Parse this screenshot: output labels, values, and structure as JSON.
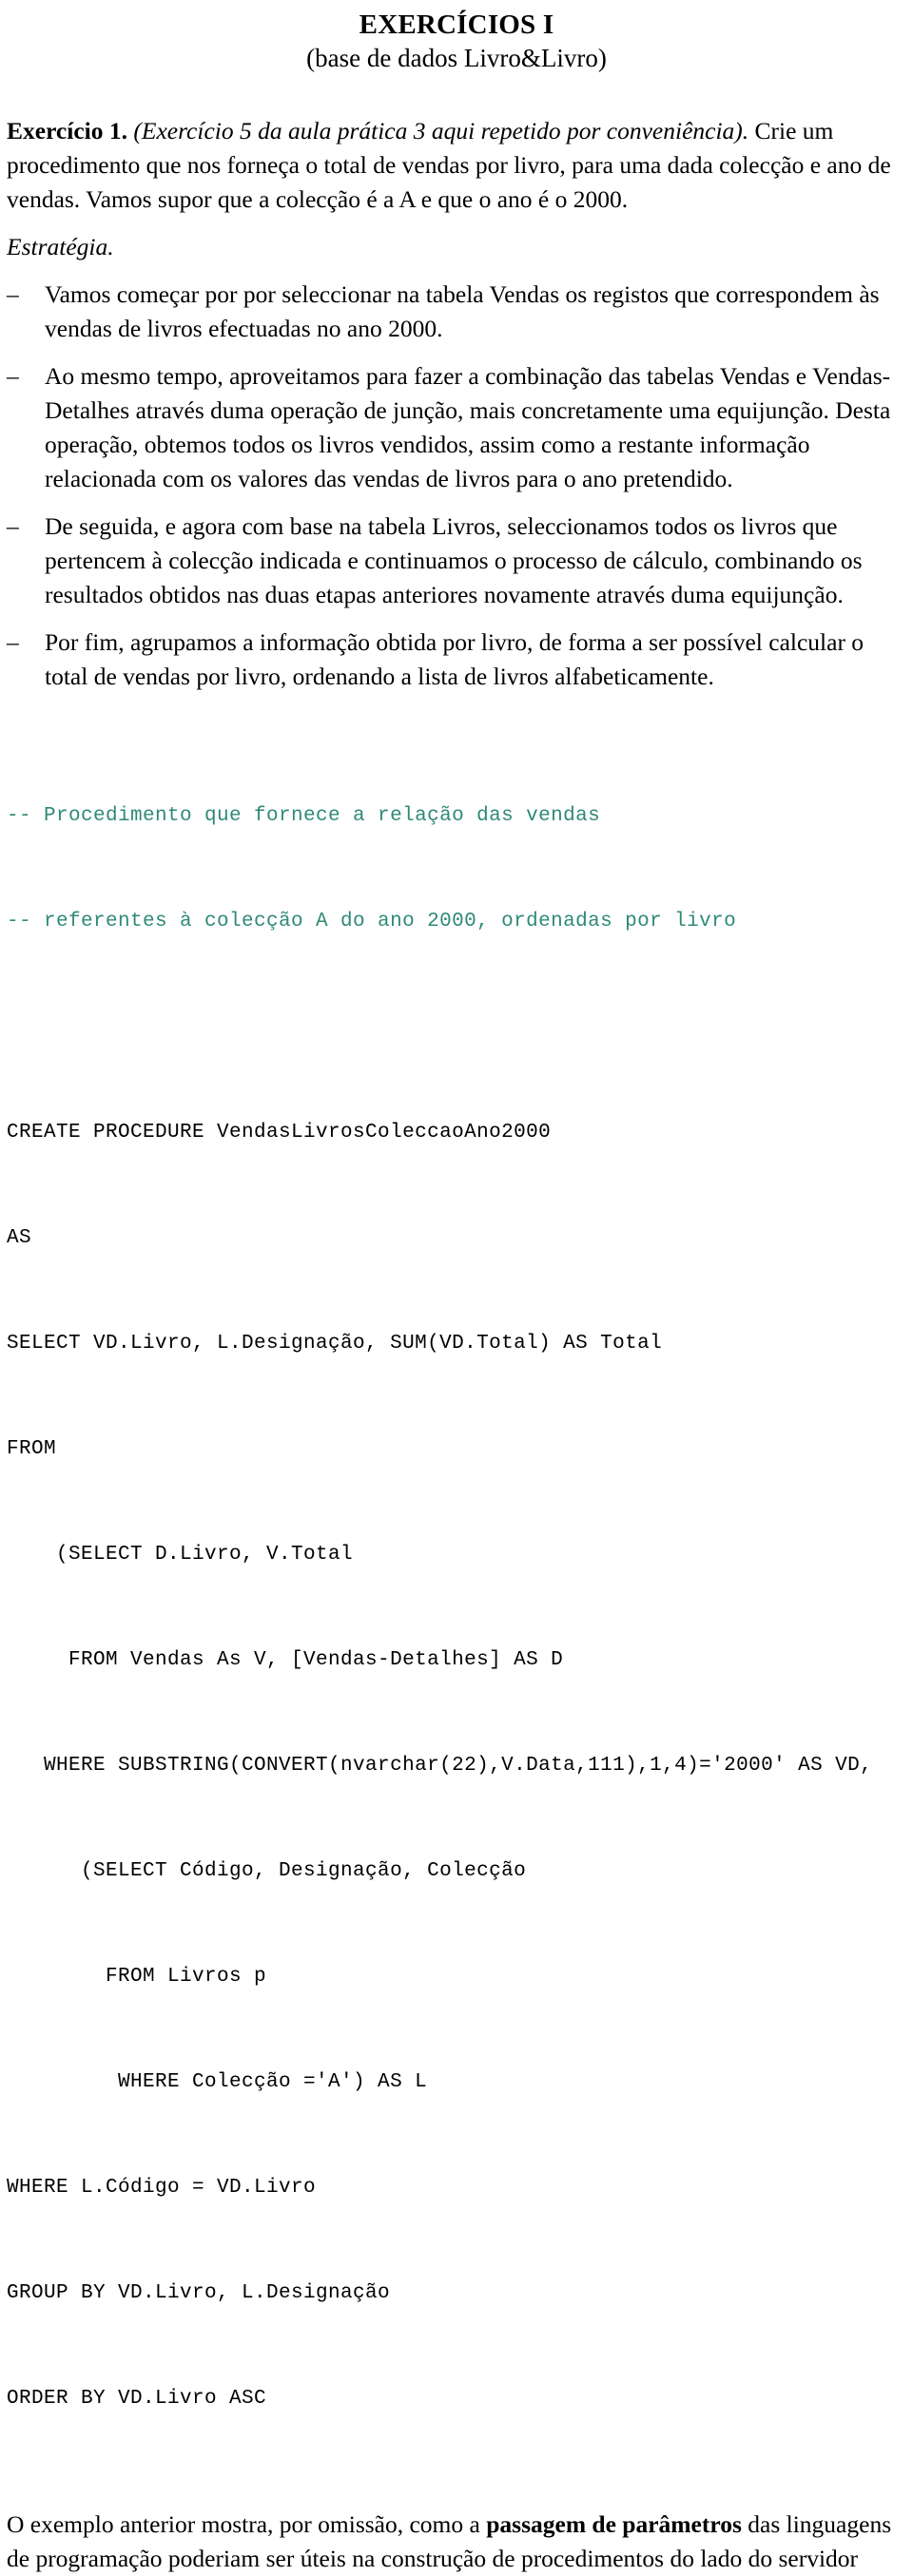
{
  "document": {
    "title": "EXERCÍCIOS I",
    "subtitle": "(base de dados Livro&Livro)"
  },
  "exercise": {
    "label": "Exercício 1.",
    "note": "(Exercício 5 da aula prática 3 aqui repetido por conveniência).",
    "statement": "Crie um procedimento que nos forneça o total de vendas por livro, para uma dada colecção e ano de vendas. Vamos supor que a colecção é a A e que o ano é o 2000."
  },
  "strategy": {
    "heading": "Estratégia.",
    "bullet_marker": "–",
    "items": [
      "Vamos começar por por seleccionar na tabela Vendas os registos que correspondem às vendas de livros efectuadas no ano 2000.",
      "Ao mesmo tempo, aproveitamos para fazer a combinação das tabelas Vendas e Vendas-Detalhes através duma operação de junção, mais concretamente uma equijunção. Desta operação, obtemos todos os livros vendidos, assim como a restante informação relacionada com os valores das vendas de livros para o ano pretendido.",
      "De seguida, e agora com base na tabela Livros, seleccionamos todos os livros que pertencem à colecção indicada e continuamos o processo de cálculo, combinando os resultados obtidos nas duas etapas anteriores novamente através duma equijunção.",
      "Por fim, agrupamos a informação obtida por livro, de forma a ser possível calcular o total de vendas por livro, ordenando a lista de livros alfabeticamente."
    ]
  },
  "code": {
    "comment_color": "#2f8a76",
    "comments": [
      "-- Procedimento que fornece a relação das vendas",
      "-- referentes à colecção A do ano 2000, ordenadas por livro"
    ],
    "lines": [
      "CREATE PROCEDURE VendasLivrosColeccaoAno2000",
      "AS",
      "SELECT VD.Livro, L.Designação, SUM(VD.Total) AS Total",
      "FROM",
      "    (SELECT D.Livro, V.Total",
      "     FROM Vendas As V, [Vendas-Detalhes] AS D",
      "   WHERE SUBSTRING(CONVERT(nvarchar(22),V.Data,111),1,4)='2000' AS VD,",
      "      (SELECT Código, Designação, Colecção",
      "        FROM Livros p",
      "         WHERE Colecção ='A') AS L",
      "WHERE L.Código = VD.Livro",
      "GROUP BY VD.Livro, L.Designação",
      "ORDER BY VD.Livro ASC"
    ]
  },
  "closing": {
    "part1": "O exemplo anterior mostra, por omissão, como a ",
    "emphasis": "passagem de parâmetros",
    "part2": " das linguagens de programação poderiam ser úteis na construção de procedimentos do lado do servidor"
  }
}
